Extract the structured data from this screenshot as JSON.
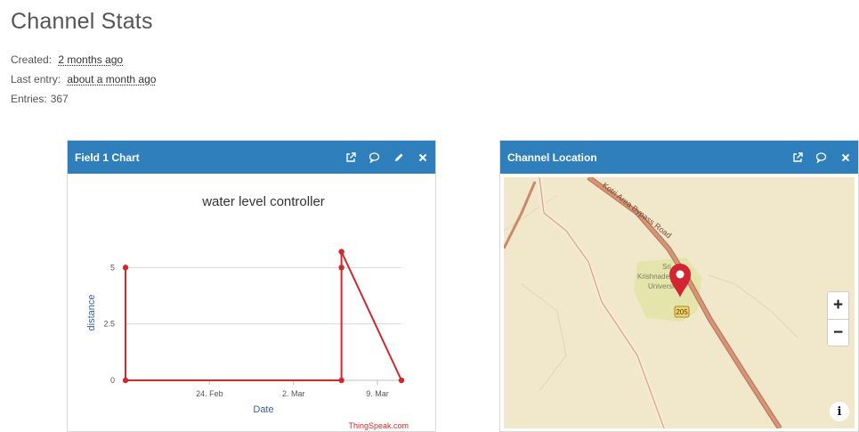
{
  "page": {
    "title": "Channel Stats",
    "created_label": "Created:",
    "created_value": "2 months ago",
    "last_entry_label": "Last entry:",
    "last_entry_value": "about a month ago",
    "entries_label": "Entries:",
    "entries_value": "367"
  },
  "widgets": {
    "chart": {
      "title": "Field 1 Chart",
      "icons": [
        "external-link-icon",
        "comment-icon",
        "pencil-icon",
        "close-icon"
      ]
    },
    "map": {
      "title": "Channel Location",
      "icons": [
        "external-link-icon",
        "comment-icon",
        "close-icon"
      ],
      "road_label": "Kotri Area Bypass Road",
      "place_label_1": "Sri",
      "place_label_2": "Krishnadevaraya",
      "place_label_3": "University",
      "road_shield": "205",
      "zoom_in": "+",
      "zoom_out": "−",
      "info": "i"
    }
  },
  "chart_data": {
    "type": "line",
    "title": "water level controller",
    "xlabel": "Date",
    "ylabel": "distance",
    "credit": "ThingSpeak.com",
    "x_ticks": [
      "24. Feb",
      "2. Mar",
      "9. Mar"
    ],
    "y_ticks": [
      "0",
      "2.5",
      "5"
    ],
    "ylim": [
      0,
      6
    ],
    "grid": true,
    "color": "#d0282e",
    "series": [
      {
        "x": [
          "2024-02-17",
          "2024-02-17",
          "2024-03-06",
          "2024-03-06",
          "2024-03-06",
          "2024-03-11"
        ],
        "values": [
          5,
          0,
          0,
          5,
          5.7,
          0
        ]
      }
    ]
  }
}
